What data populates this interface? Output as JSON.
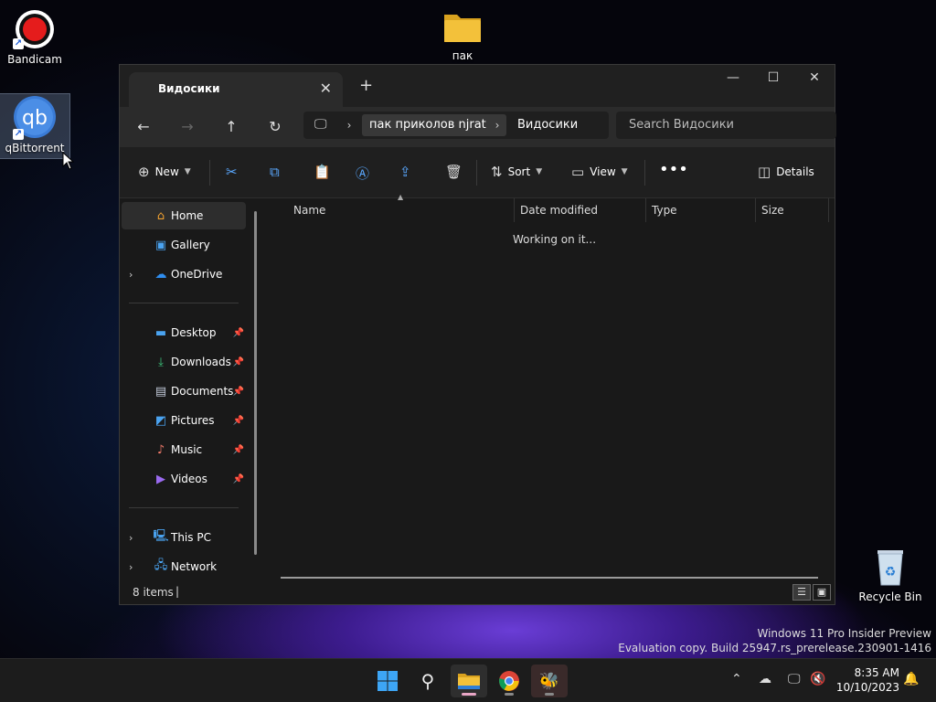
{
  "desktop": {
    "icons": {
      "bandicam": "Bandicam",
      "folder": "пак",
      "qbittorrent": "qBittorrent",
      "recycle_bin": "Recycle Bin"
    }
  },
  "explorer": {
    "tab_title": "Видосики",
    "breadcrumb": [
      "пак приколов njrat",
      "Видосики"
    ],
    "search_placeholder": "Search Видосики",
    "commands": {
      "new": "New",
      "sort": "Sort",
      "view": "View",
      "details": "Details"
    },
    "nav": {
      "home": "Home",
      "gallery": "Gallery",
      "onedrive": "OneDrive",
      "desktop": "Desktop",
      "downloads": "Downloads",
      "documents": "Documents",
      "pictures": "Pictures",
      "music": "Music",
      "videos": "Videos",
      "this_pc": "This PC",
      "network": "Network"
    },
    "columns": [
      "Name",
      "Date modified",
      "Type",
      "Size"
    ],
    "status_message": "Working on it...",
    "item_count": "8 items"
  },
  "watermark": {
    "line1": "Windows 11 Pro Insider Preview",
    "line2": "Evaluation copy. Build 25947.rs_prerelease.230901-1416"
  },
  "clock": {
    "time": "8:35 AM",
    "date": "10/10/2023"
  },
  "colors": {
    "accent": "#5aa8ff",
    "bandicam_red": "#e51c1c",
    "folder_yellow": "#f3c13a",
    "qbittorrent_blue": "#3a7bd5"
  }
}
